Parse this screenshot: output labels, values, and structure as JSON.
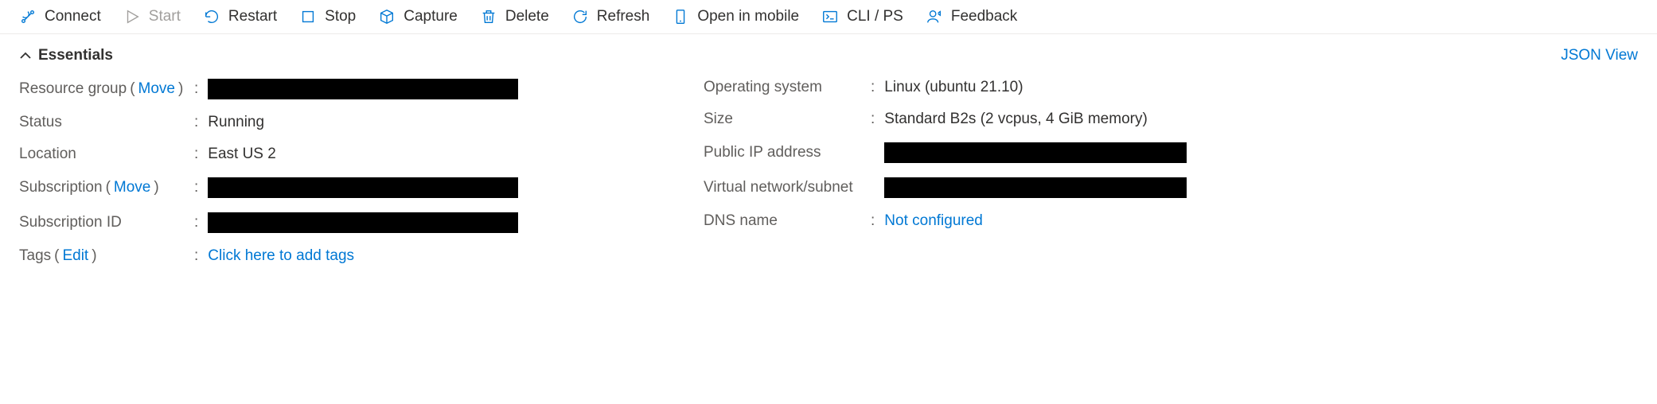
{
  "toolbar": {
    "connect": "Connect",
    "start": "Start",
    "restart": "Restart",
    "stop": "Stop",
    "capture": "Capture",
    "delete": "Delete",
    "refresh": "Refresh",
    "open_mobile": "Open in mobile",
    "cli_ps": "CLI / PS",
    "feedback": "Feedback"
  },
  "essentials": {
    "header": "Essentials",
    "json_view": "JSON View",
    "move_label": "Move",
    "edit_label": "Edit",
    "left": {
      "resource_group_label": "Resource group",
      "status_label": "Status",
      "status_value": "Running",
      "location_label": "Location",
      "location_value": "East US 2",
      "subscription_label": "Subscription",
      "subscription_id_label": "Subscription ID"
    },
    "right": {
      "os_label": "Operating system",
      "os_value": "Linux (ubuntu 21.10)",
      "size_label": "Size",
      "size_value": "Standard B2s (2 vcpus, 4 GiB memory)",
      "public_ip_label": "Public IP address",
      "vnet_label": "Virtual network/subnet",
      "dns_label": "DNS name",
      "dns_value": "Not configured"
    },
    "tags_label": "Tags",
    "tags_value": "Click here to add tags"
  }
}
